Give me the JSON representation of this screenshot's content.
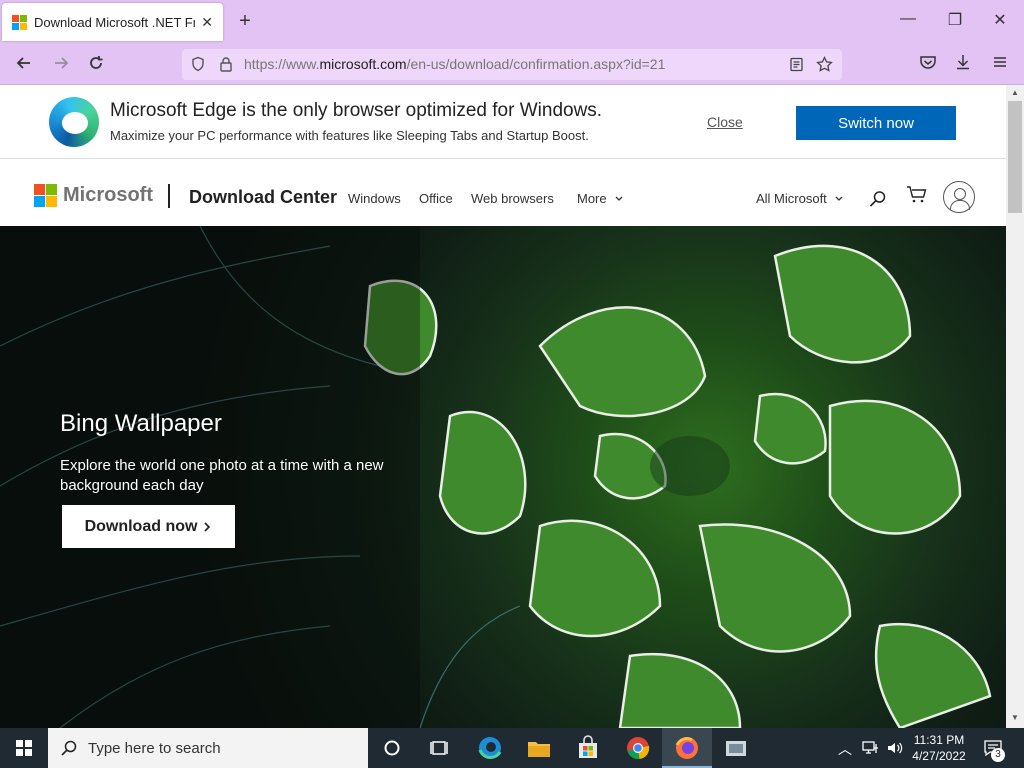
{
  "browser": {
    "tab_title": "Download Microsoft .NET Fram",
    "tab_close": "✕",
    "new_tab": "+",
    "window_minimize": "—",
    "window_restore": "❐",
    "window_close": "✕",
    "url_prefix": "https://www.",
    "url_domain": "microsoft.com",
    "url_path": "/en-us/download/confirmation.aspx?id=21",
    "accent_color": "#e3c2f4"
  },
  "edge_banner": {
    "title": "Microsoft Edge is the only browser optimized for Windows.",
    "subtitle": "Maximize your PC performance with features like Sleeping Tabs and Startup Boost.",
    "close_label": "Close",
    "switch_label": "Switch now",
    "button_color": "#0067b8"
  },
  "site_header": {
    "brand": "Microsoft",
    "section_title": "Download Center",
    "nav": [
      "Windows",
      "Office",
      "Web browsers",
      "More"
    ],
    "all_microsoft": "All Microsoft"
  },
  "hero": {
    "title": "Bing Wallpaper",
    "text": "Explore the world one photo at a time with a new background each day",
    "button_label": "Download now"
  },
  "taskbar": {
    "search_placeholder": "Type here to search",
    "time": "11:31 PM",
    "date": "4/27/2022",
    "notification_count": "3"
  }
}
